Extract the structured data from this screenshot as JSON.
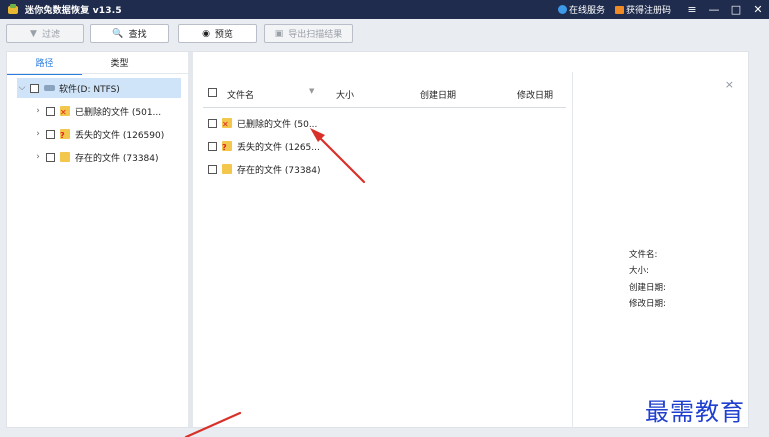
{
  "titlebar": {
    "app_title": "迷你兔数据恢复 v13.5",
    "online_service": "在线服务",
    "get_code": "获得注册码",
    "menu_glyph": "≡",
    "minimize_glyph": "—",
    "maximize_glyph": "□",
    "close_glyph": "✕"
  },
  "toolbar": {
    "filter": "过滤",
    "find": "查找",
    "preview": "预览",
    "export": "导出扫描结果"
  },
  "left": {
    "tabs": [
      "路径",
      "类型"
    ],
    "tree": {
      "root": "软件(D: NTFS)",
      "children": [
        {
          "label": "已删除的文件 (501...",
          "icon": "deleted-folder"
        },
        {
          "label": "丢失的文件 (126590)",
          "icon": "lost-folder"
        },
        {
          "label": "存在的文件 (73384)",
          "icon": "existing-folder"
        }
      ]
    }
  },
  "list": {
    "headers": {
      "name": "文件名",
      "size": "大小",
      "created": "创建日期",
      "modified": "修改日期"
    },
    "rows": [
      {
        "name": "已删除的文件 (50..."
      },
      {
        "name": "丢失的文件 (1265..."
      },
      {
        "name": "存在的文件 (73384)"
      }
    ]
  },
  "detail": {
    "file_name": "文件名:",
    "size": "大小:",
    "created": "创建日期:",
    "modified": "修改日期:"
  },
  "watermark": "最需教育",
  "colors": {
    "titlebar": "#1f2c4d",
    "accent": "#2c7de0",
    "selected": "#cfe4f8",
    "arrow": "#d8312a",
    "watermark": "#1f3fcf"
  }
}
